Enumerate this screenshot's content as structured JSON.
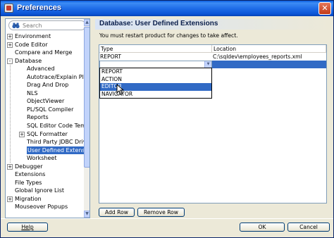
{
  "window": {
    "title": "Preferences",
    "close_glyph": "✕"
  },
  "search": {
    "placeholder": "Search",
    "icon": "binoculars-icon"
  },
  "tree": [
    {
      "label": "Environment",
      "level": 0,
      "toggle": "+"
    },
    {
      "label": "Code Editor",
      "level": 0,
      "toggle": "+"
    },
    {
      "label": "Compare and Merge",
      "level": 0,
      "toggle": ""
    },
    {
      "label": "Database",
      "level": 0,
      "toggle": "-"
    },
    {
      "label": "Advanced",
      "level": 1,
      "toggle": ""
    },
    {
      "label": "Autotrace/Explain Plan",
      "level": 1,
      "toggle": ""
    },
    {
      "label": "Drag And Drop",
      "level": 1,
      "toggle": ""
    },
    {
      "label": "NLS",
      "level": 1,
      "toggle": ""
    },
    {
      "label": "ObjectViewer",
      "level": 1,
      "toggle": ""
    },
    {
      "label": "PL/SQL Compiler",
      "level": 1,
      "toggle": ""
    },
    {
      "label": "Reports",
      "level": 1,
      "toggle": ""
    },
    {
      "label": "SQL Editor Code Template",
      "level": 1,
      "toggle": ""
    },
    {
      "label": "SQL Formatter",
      "level": 1,
      "toggle": "+"
    },
    {
      "label": "Third Party JDBC Drivers",
      "level": 1,
      "toggle": ""
    },
    {
      "label": "User Defined Extensions",
      "level": 1,
      "toggle": "",
      "selected": true
    },
    {
      "label": "Worksheet",
      "level": 1,
      "toggle": ""
    },
    {
      "label": "Debugger",
      "level": 0,
      "toggle": "+"
    },
    {
      "label": "Extensions",
      "level": 0,
      "toggle": ""
    },
    {
      "label": "File Types",
      "level": 0,
      "toggle": ""
    },
    {
      "label": "Global Ignore List",
      "level": 0,
      "toggle": ""
    },
    {
      "label": "Migration",
      "level": 0,
      "toggle": "+"
    },
    {
      "label": "Mouseover Popups",
      "level": 0,
      "toggle": ""
    }
  ],
  "content": {
    "title": "Database: User Defined Extensions",
    "notice": "You must restart product for changes to take affect."
  },
  "table": {
    "columns": [
      "Type",
      "Location"
    ],
    "rows": [
      {
        "type": "REPORT",
        "location": "C:\\sqldev\\employees_reports.xml"
      }
    ],
    "editing_value": ""
  },
  "dropdown": {
    "options": [
      "REPORT",
      "ACTION",
      "EDITOR",
      "NAVIGATOR"
    ],
    "highlighted": "EDITOR"
  },
  "buttons": {
    "add_row": "Add Row",
    "remove_row": "Remove Row",
    "help": "Help",
    "ok": "OK",
    "cancel": "Cancel"
  },
  "colors": {
    "selection": "#316ac5",
    "titlebar": "#0b55d6",
    "dialog_bg": "#ece9d8"
  }
}
